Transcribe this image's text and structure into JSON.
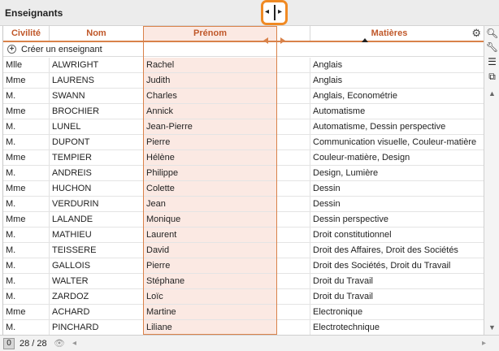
{
  "panel": {
    "title": "Enseignants"
  },
  "columns": {
    "civilite": "Civilité",
    "nom": "Nom",
    "prenom": "Prénom",
    "matieres": "Matières"
  },
  "create_label": "Créer un enseignant",
  "rows": [
    {
      "civ": "Mlle",
      "nom": "ALWRIGHT",
      "prenom": "Rachel",
      "matieres": "Anglais"
    },
    {
      "civ": "Mme",
      "nom": "LAURENS",
      "prenom": "Judith",
      "matieres": "Anglais"
    },
    {
      "civ": "M.",
      "nom": "SWANN",
      "prenom": "Charles",
      "matieres": "Anglais, Econométrie"
    },
    {
      "civ": "Mme",
      "nom": "BROCHIER",
      "prenom": "Annick",
      "matieres": "Automatisme"
    },
    {
      "civ": "M.",
      "nom": "LUNEL",
      "prenom": "Jean-Pierre",
      "matieres": "Automatisme, Dessin perspective"
    },
    {
      "civ": "M.",
      "nom": "DUPONT",
      "prenom": "Pierre",
      "matieres": "Communication visuelle, Couleur-matière"
    },
    {
      "civ": "Mme",
      "nom": "TEMPIER",
      "prenom": "Hélène",
      "matieres": "Couleur-matière, Design"
    },
    {
      "civ": "M.",
      "nom": "ANDREIS",
      "prenom": "Philippe",
      "matieres": "Design, Lumière"
    },
    {
      "civ": "Mme",
      "nom": "HUCHON",
      "prenom": "Colette",
      "matieres": "Dessin"
    },
    {
      "civ": "M.",
      "nom": "VERDURIN",
      "prenom": "Jean",
      "matieres": "Dessin"
    },
    {
      "civ": "Mme",
      "nom": "LALANDE",
      "prenom": "Monique",
      "matieres": "Dessin perspective"
    },
    {
      "civ": "M.",
      "nom": "MATHIEU",
      "prenom": "Laurent",
      "matieres": "Droit constitutionnel"
    },
    {
      "civ": "M.",
      "nom": "TEISSERE",
      "prenom": "David",
      "matieres": "Droit des Affaires, Droit des Sociétés"
    },
    {
      "civ": "M.",
      "nom": "GALLOIS",
      "prenom": "Pierre",
      "matieres": "Droit des Sociétés, Droit du Travail"
    },
    {
      "civ": "M.",
      "nom": "WALTER",
      "prenom": "Stéphane",
      "matieres": "Droit du Travail"
    },
    {
      "civ": "M.",
      "nom": "ZARDOZ",
      "prenom": "Loïc",
      "matieres": "Droit du Travail"
    },
    {
      "civ": "Mme",
      "nom": "ACHARD",
      "prenom": "Martine",
      "matieres": "Electronique"
    },
    {
      "civ": "M.",
      "nom": "PINCHARD",
      "prenom": "Liliane",
      "matieres": "Electrotechnique"
    }
  ],
  "footer": {
    "selected": "0",
    "count": "28 / 28"
  },
  "colors": {
    "accent": "#c0582a",
    "highlight": "#fbe9e3",
    "callout": "#f08a24"
  },
  "icons": {
    "gear": "gear-icon",
    "search": "search-icon",
    "wrench": "wrench-icon",
    "list": "list-icon",
    "copy": "copy-icon",
    "eye": "eye-icon",
    "resize": "column-resize-icon"
  }
}
